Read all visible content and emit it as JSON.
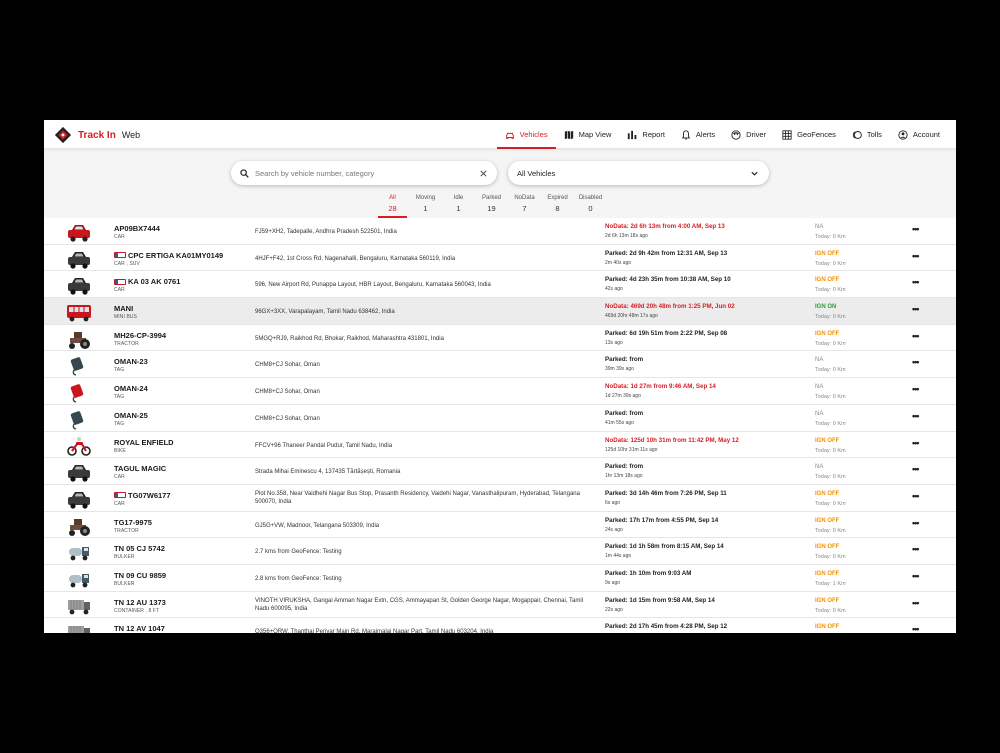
{
  "brand": {
    "name": "Track In",
    "sub": "Web"
  },
  "colors": {
    "accent": "#d32026",
    "ign_off": "#f39200",
    "ign_on": "#2e9b3c"
  },
  "nav": [
    {
      "label": "Vehicles",
      "icon": "car-icon",
      "active": true
    },
    {
      "label": "Map View",
      "icon": "map-icon",
      "active": false
    },
    {
      "label": "Report",
      "icon": "bar-chart-icon",
      "active": false
    },
    {
      "label": "Alerts",
      "icon": "bell-icon",
      "active": false
    },
    {
      "label": "Driver",
      "icon": "driver-icon",
      "active": false
    },
    {
      "label": "GeoFences",
      "icon": "grid-icon",
      "active": false
    },
    {
      "label": "Tolls",
      "icon": "toll-icon",
      "active": false
    },
    {
      "label": "Account",
      "icon": "account-icon",
      "active": false
    }
  ],
  "search": {
    "placeholder": "Search by vehicle number, category",
    "value": ""
  },
  "filter": {
    "selected": "All Vehicles"
  },
  "tabs": [
    {
      "label": "All",
      "count": "28",
      "active": true
    },
    {
      "label": "Moving",
      "count": "1"
    },
    {
      "label": "Idle",
      "count": "1"
    },
    {
      "label": "Parked",
      "count": "19"
    },
    {
      "label": "NoData",
      "count": "7"
    },
    {
      "label": "Expired",
      "count": "8"
    },
    {
      "label": "Disabled",
      "count": "0"
    }
  ],
  "vehicles": [
    {
      "name": "AP09BX7444",
      "category": "CAR",
      "icon": "car-red-icon",
      "flag": false,
      "address": "FJ59+XH2, Tadepalle, Andhra Pradesh 522501, India",
      "status": "NoData: 2d 6h 13m from 4:00 AM, Sep 13",
      "status_type": "red",
      "ago": "2d 6h 13m 18s  ago",
      "ign": "NA",
      "ign_type": "na",
      "today": "Today: 0 Km"
    },
    {
      "name": "CPC ERTIGA KA01MY0149",
      "category": "CAR , SUV",
      "icon": "car-dark-icon",
      "flag": true,
      "address": "4HJF+F42, 1st Cross Rd, Nagenahalli, Bengaluru, Karnataka 560119, India",
      "status": "Parked: 2d 9h 42m from 12:31 AM, Sep 13",
      "status_type": "dark",
      "ago": "2m 40s  ago",
      "ign": "IGN OFF",
      "ign_type": "off",
      "today": "Today: 0 Km"
    },
    {
      "name": "KA 03 AK 0761",
      "category": "CAR",
      "icon": "car-dark-icon",
      "flag": true,
      "address": "596, New Airport Rd, Punappa Layout, HBR Layout, Bengaluru, Karnataka 560043, India",
      "status": "Parked: 4d 23h 35m from 10:38 AM, Sep 10",
      "status_type": "dark",
      "ago": "42s  ago",
      "ign": "IGN OFF",
      "ign_type": "off",
      "today": "Today: 0 Km"
    },
    {
      "name": "MANI",
      "category": "MINI BUS",
      "icon": "bus-red-icon",
      "flag": false,
      "address": "96GX+3XX, Varapalayam, Tamil Nadu 638462, India",
      "status": "NoData: 469d 20h 48m from 1:25 PM, Jun 02",
      "status_type": "red",
      "ago": "469d 20hr 48m 17s  ago",
      "ign": "IGN ON",
      "ign_type": "on",
      "today": "Today: 0 Km",
      "highlight": true
    },
    {
      "name": "MH26-CP-3994",
      "category": "TRACTOR",
      "icon": "tractor-icon",
      "flag": false,
      "address": "5MGQ+RJ9, Raikhod Rd, Bhokar, Raikhod, Maharashtra 431801, India",
      "status": "Parked: 6d 19h 51m from 2:22 PM, Sep 08",
      "status_type": "dark",
      "ago": "13s  ago",
      "ign": "IGN OFF",
      "ign_type": "off",
      "today": "Today: 0 Km"
    },
    {
      "name": "OMAN-23",
      "category": "TAG",
      "icon": "tag-dark-icon",
      "flag": false,
      "address": "CHM8+CJ Sohar, Oman",
      "status": "Parked:  from",
      "status_type": "dark",
      "ago": "39m 39s  ago",
      "ign": "NA",
      "ign_type": "na",
      "today": "Today: 0 Km"
    },
    {
      "name": "OMAN-24",
      "category": "TAG",
      "icon": "tag-red-icon",
      "flag": false,
      "address": "CHM8+CJ Sohar, Oman",
      "status": "NoData: 1d 27m from 9:46 AM, Sep 14",
      "status_type": "red",
      "ago": "1d 27m 39s  ago",
      "ign": "NA",
      "ign_type": "na",
      "today": "Today: 0 Km"
    },
    {
      "name": "OMAN-25",
      "category": "TAG",
      "icon": "tag-dark-icon",
      "flag": false,
      "address": "CHM8+CJ Sohar, Oman",
      "status": "Parked:  from",
      "status_type": "dark",
      "ago": "41m 55s  ago",
      "ign": "NA",
      "ign_type": "na",
      "today": "Today: 0 Km"
    },
    {
      "name": "ROYAL ENFIELD",
      "category": "BIKE",
      "icon": "bike-red-icon",
      "flag": false,
      "address": "FFCV+96 Thaneer Pandal Pudur, Tamil Nadu, India",
      "status": "NoData: 125d 10h 31m from 11:42 PM, May 12",
      "status_type": "red",
      "ago": "125d 10hr 31m 11s  ago",
      "ign": "IGN OFF",
      "ign_type": "off",
      "today": "Today: 0 Km"
    },
    {
      "name": "TAGUL MAGIC",
      "category": "CAR",
      "icon": "car-dark-icon",
      "flag": false,
      "address": "Strada Mihai Eminescu 4, 137435 Tărtășești, Romania",
      "status": "Parked:  from",
      "status_type": "dark",
      "ago": "1hr 13m 18s  ago",
      "ign": "NA",
      "ign_type": "na",
      "today": "Today: 0 Km"
    },
    {
      "name": "TG07W6177",
      "category": "CAR",
      "icon": "car-dark-icon",
      "flag": true,
      "address": "Plot No.358, Near Vaidhehi Nagar Bus Stop, Prasanth Residency, Vaidehi Nagar, Vanasthalipuram, Hyderabad, Telangana 500070, India",
      "status": "Parked: 3d 14h 46m from 7:26 PM, Sep 11",
      "status_type": "dark",
      "ago": "6s  ago",
      "ign": "IGN OFF",
      "ign_type": "off",
      "today": "Today: 0 Km"
    },
    {
      "name": "TG17-9975",
      "category": "TRACTOR",
      "icon": "tractor-icon",
      "flag": false,
      "address": "GJ5G+VW, Madnoor, Telangana 503309, India",
      "status": "Parked: 17h 17m from 4:55 PM, Sep 14",
      "status_type": "dark",
      "ago": "24s  ago",
      "ign": "IGN OFF",
      "ign_type": "off",
      "today": "Today: 0 Km"
    },
    {
      "name": "TN 05 CJ 5742",
      "category": "BULKER",
      "icon": "bulker-icon",
      "flag": false,
      "address": "2.7 kms from GeoFence: Testing",
      "status": "Parked: 1d 1h 58m from 8:15 AM, Sep 14",
      "status_type": "dark",
      "ago": "1m 44s  ago",
      "ign": "IGN OFF",
      "ign_type": "off",
      "today": "Today: 0 Km"
    },
    {
      "name": "TN 09 CU 9859",
      "category": "BULKER",
      "icon": "bulker-icon",
      "flag": false,
      "address": "2.8 kms from GeoFence: Testing",
      "status": "Parked: 1h 10m from 9:03 AM",
      "status_type": "dark",
      "ago": "9s  ago",
      "ign": "IGN OFF",
      "ign_type": "off",
      "today": "Today: 1 Km"
    },
    {
      "name": "TN 12 AU 1373",
      "category": "CONTAINER , 8 FT",
      "icon": "container-icon",
      "flag": false,
      "address": "VINOTH VIRUKSHA, Gangai Amman Nagar Extn, CGS, Ammayapan St, Golden George Nagar, Mogappair, Chennai, Tamil Nadu 600095, India",
      "status": "Parked: 1d 15m from 9:58 AM, Sep 14",
      "status_type": "dark",
      "ago": "22s  ago",
      "ign": "IGN OFF",
      "ign_type": "off",
      "today": "Today: 0 Km"
    },
    {
      "name": "TN 12 AV 1047",
      "category": "",
      "icon": "container-icon",
      "flag": false,
      "address": "Q356+QRW, Thanthai Periyar Main Rd, Maraimalai Nagar Part, Tamil Nadu 603204, India",
      "status": "Parked: 2d 17h 45m from 4:28 PM, Sep 12",
      "status_type": "dark",
      "ago": "",
      "ign": "IGN OFF",
      "ign_type": "off",
      "today": ""
    }
  ]
}
